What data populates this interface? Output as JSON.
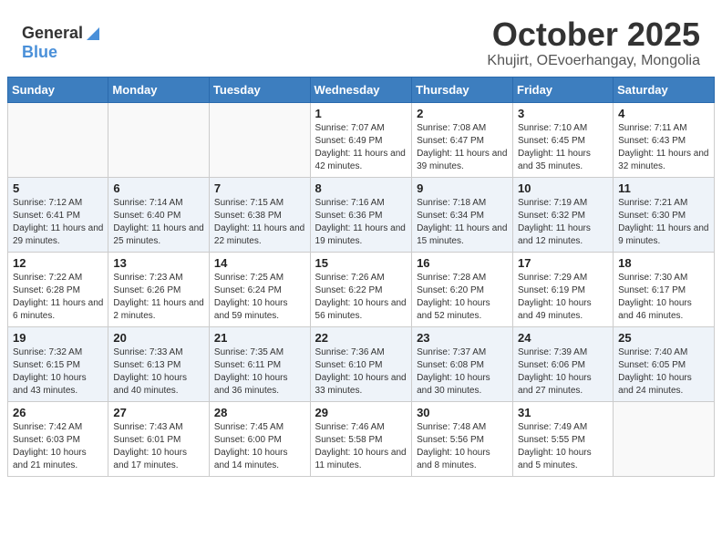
{
  "header": {
    "logo_general": "General",
    "logo_blue": "Blue",
    "title": "October 2025",
    "subtitle": "Khujirt, OEvoerhangay, Mongolia"
  },
  "weekdays": [
    "Sunday",
    "Monday",
    "Tuesday",
    "Wednesday",
    "Thursday",
    "Friday",
    "Saturday"
  ],
  "weeks": [
    [
      {
        "day": "",
        "info": ""
      },
      {
        "day": "",
        "info": ""
      },
      {
        "day": "",
        "info": ""
      },
      {
        "day": "1",
        "info": "Sunrise: 7:07 AM\nSunset: 6:49 PM\nDaylight: 11 hours and 42 minutes."
      },
      {
        "day": "2",
        "info": "Sunrise: 7:08 AM\nSunset: 6:47 PM\nDaylight: 11 hours and 39 minutes."
      },
      {
        "day": "3",
        "info": "Sunrise: 7:10 AM\nSunset: 6:45 PM\nDaylight: 11 hours and 35 minutes."
      },
      {
        "day": "4",
        "info": "Sunrise: 7:11 AM\nSunset: 6:43 PM\nDaylight: 11 hours and 32 minutes."
      }
    ],
    [
      {
        "day": "5",
        "info": "Sunrise: 7:12 AM\nSunset: 6:41 PM\nDaylight: 11 hours and 29 minutes."
      },
      {
        "day": "6",
        "info": "Sunrise: 7:14 AM\nSunset: 6:40 PM\nDaylight: 11 hours and 25 minutes."
      },
      {
        "day": "7",
        "info": "Sunrise: 7:15 AM\nSunset: 6:38 PM\nDaylight: 11 hours and 22 minutes."
      },
      {
        "day": "8",
        "info": "Sunrise: 7:16 AM\nSunset: 6:36 PM\nDaylight: 11 hours and 19 minutes."
      },
      {
        "day": "9",
        "info": "Sunrise: 7:18 AM\nSunset: 6:34 PM\nDaylight: 11 hours and 15 minutes."
      },
      {
        "day": "10",
        "info": "Sunrise: 7:19 AM\nSunset: 6:32 PM\nDaylight: 11 hours and 12 minutes."
      },
      {
        "day": "11",
        "info": "Sunrise: 7:21 AM\nSunset: 6:30 PM\nDaylight: 11 hours and 9 minutes."
      }
    ],
    [
      {
        "day": "12",
        "info": "Sunrise: 7:22 AM\nSunset: 6:28 PM\nDaylight: 11 hours and 6 minutes."
      },
      {
        "day": "13",
        "info": "Sunrise: 7:23 AM\nSunset: 6:26 PM\nDaylight: 11 hours and 2 minutes."
      },
      {
        "day": "14",
        "info": "Sunrise: 7:25 AM\nSunset: 6:24 PM\nDaylight: 10 hours and 59 minutes."
      },
      {
        "day": "15",
        "info": "Sunrise: 7:26 AM\nSunset: 6:22 PM\nDaylight: 10 hours and 56 minutes."
      },
      {
        "day": "16",
        "info": "Sunrise: 7:28 AM\nSunset: 6:20 PM\nDaylight: 10 hours and 52 minutes."
      },
      {
        "day": "17",
        "info": "Sunrise: 7:29 AM\nSunset: 6:19 PM\nDaylight: 10 hours and 49 minutes."
      },
      {
        "day": "18",
        "info": "Sunrise: 7:30 AM\nSunset: 6:17 PM\nDaylight: 10 hours and 46 minutes."
      }
    ],
    [
      {
        "day": "19",
        "info": "Sunrise: 7:32 AM\nSunset: 6:15 PM\nDaylight: 10 hours and 43 minutes."
      },
      {
        "day": "20",
        "info": "Sunrise: 7:33 AM\nSunset: 6:13 PM\nDaylight: 10 hours and 40 minutes."
      },
      {
        "day": "21",
        "info": "Sunrise: 7:35 AM\nSunset: 6:11 PM\nDaylight: 10 hours and 36 minutes."
      },
      {
        "day": "22",
        "info": "Sunrise: 7:36 AM\nSunset: 6:10 PM\nDaylight: 10 hours and 33 minutes."
      },
      {
        "day": "23",
        "info": "Sunrise: 7:37 AM\nSunset: 6:08 PM\nDaylight: 10 hours and 30 minutes."
      },
      {
        "day": "24",
        "info": "Sunrise: 7:39 AM\nSunset: 6:06 PM\nDaylight: 10 hours and 27 minutes."
      },
      {
        "day": "25",
        "info": "Sunrise: 7:40 AM\nSunset: 6:05 PM\nDaylight: 10 hours and 24 minutes."
      }
    ],
    [
      {
        "day": "26",
        "info": "Sunrise: 7:42 AM\nSunset: 6:03 PM\nDaylight: 10 hours and 21 minutes."
      },
      {
        "day": "27",
        "info": "Sunrise: 7:43 AM\nSunset: 6:01 PM\nDaylight: 10 hours and 17 minutes."
      },
      {
        "day": "28",
        "info": "Sunrise: 7:45 AM\nSunset: 6:00 PM\nDaylight: 10 hours and 14 minutes."
      },
      {
        "day": "29",
        "info": "Sunrise: 7:46 AM\nSunset: 5:58 PM\nDaylight: 10 hours and 11 minutes."
      },
      {
        "day": "30",
        "info": "Sunrise: 7:48 AM\nSunset: 5:56 PM\nDaylight: 10 hours and 8 minutes."
      },
      {
        "day": "31",
        "info": "Sunrise: 7:49 AM\nSunset: 5:55 PM\nDaylight: 10 hours and 5 minutes."
      },
      {
        "day": "",
        "info": ""
      }
    ]
  ]
}
